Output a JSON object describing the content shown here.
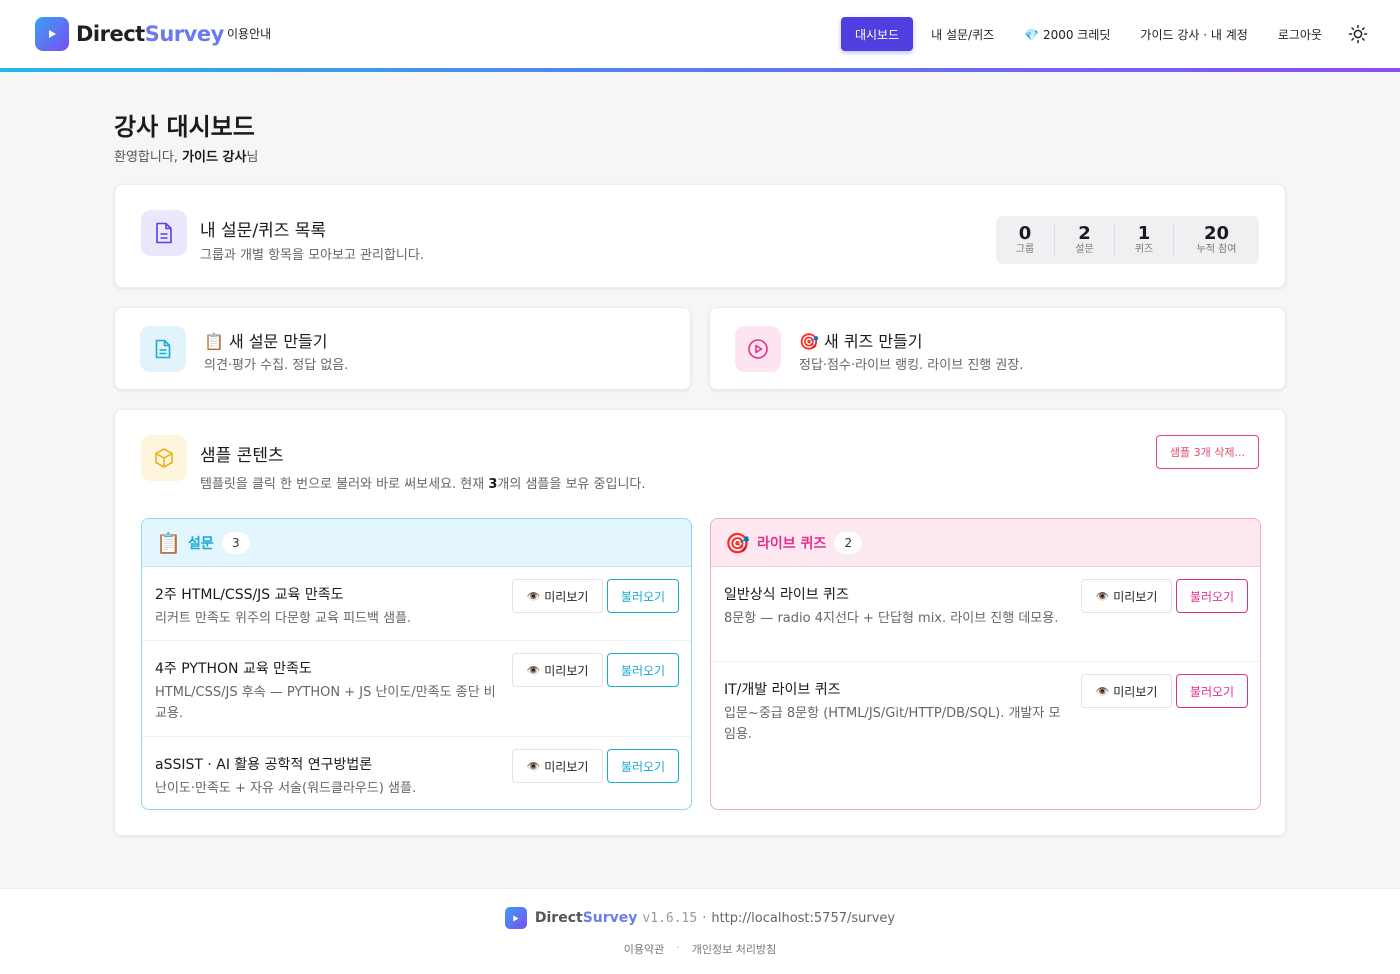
{
  "header": {
    "logo_direct": "Direct",
    "logo_survey": "Survey",
    "guide_link": "이용안내",
    "nav": [
      "대시보드",
      "내 설문/퀴즈",
      "💎 2000 크레딧",
      "가이드 강사 · 내 계정",
      "로그아웃"
    ],
    "theme_icon": "sun-icon"
  },
  "page": {
    "title": "강사 대시보드",
    "welcome_pre": "환영합니다, ",
    "welcome_name": "가이드 강사",
    "welcome_post": "님"
  },
  "overview": {
    "title": "내 설문/퀴즈 목록",
    "subtitle": "그룹과 개별 항목을 모아보고 관리합니다.",
    "stats": [
      {
        "value": "0",
        "label": "그룹"
      },
      {
        "value": "2",
        "label": "설문"
      },
      {
        "value": "1",
        "label": "퀴즈"
      },
      {
        "value": "20",
        "label": "누적 참여"
      }
    ]
  },
  "create_survey": {
    "title": "📋 새 설문 만들기",
    "subtitle": "의견·평가 수집. 정답 없음."
  },
  "create_quiz": {
    "title": "🎯 새 퀴즈 만들기",
    "subtitle": "정답·점수·라이브 랭킹. 라이브 진행 권장."
  },
  "samples": {
    "title": "샘플 콘텐츠",
    "subtitle_pre": "템플릿을 클릭 한 번으로 불러와 바로 써보세요. 현재 ",
    "subtitle_count": "3",
    "subtitle_post": "개의 샘플을 보유 중입니다.",
    "delete_label": "샘플 3개 삭제...",
    "preview_label": "미리보기",
    "load_label": "불러오기",
    "survey_panel": {
      "emoji": "📋",
      "title": "설문",
      "count": "3",
      "items": [
        {
          "title": "2주 HTML/CSS/JS 교육 만족도",
          "desc": "리커트 만족도 위주의 다문항 교육 피드백 샘플."
        },
        {
          "title": "4주 PYTHON 교육 만족도",
          "desc": "HTML/CSS/JS 후속 — PYTHON + JS 난이도/만족도 종단 비교용."
        },
        {
          "title": "aSSIST · AI 활용 공학적 연구방법론",
          "desc": "난이도·만족도 + 자유 서술(워드클라우드) 샘플."
        }
      ]
    },
    "quiz_panel": {
      "emoji": "🎯",
      "title": "라이브 퀴즈",
      "count": "2",
      "items": [
        {
          "title": "일반상식 라이브 퀴즈",
          "desc": "8문항 — radio 4지선다 + 단답형 mix. 라이브 진행 데모용."
        },
        {
          "title": "IT/개발 라이브 퀴즈",
          "desc": "입문~중급 8문항 (HTML/JS/Git/HTTP/DB/SQL). 개발자 모임용."
        }
      ]
    }
  },
  "footer": {
    "brand_direct": "Direct",
    "brand_survey": "Survey",
    "version": "v1.6.15",
    "sep": "·",
    "url": "http://localhost:5757/survey",
    "terms": "이용약관",
    "dot": "·",
    "privacy": "개인정보 처리방침"
  },
  "colors": {
    "primary": "#4f3fe0",
    "survey_accent": "#18a9d8",
    "quiz_accent": "#e2308a",
    "danger": "#e24a6a"
  }
}
